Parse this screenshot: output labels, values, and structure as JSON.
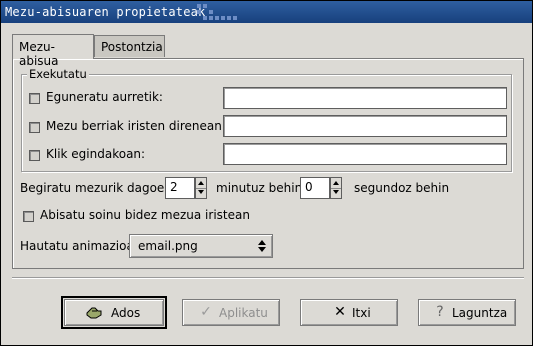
{
  "window": {
    "title": "Mezu-abisuaren propietateak"
  },
  "tabs": [
    {
      "label": "Mezu-abisua",
      "active": true
    },
    {
      "label": "Postontzia",
      "active": false
    }
  ],
  "exekutatu": {
    "group_label": "Exekutatu",
    "rows": [
      {
        "label": "Eguneratu aurretik:",
        "checked": false,
        "value": ""
      },
      {
        "label": "Mezu berriak iristen direnean:",
        "checked": false,
        "value": ""
      },
      {
        "label": "Klik egindakoan:",
        "checked": false,
        "value": ""
      }
    ]
  },
  "interval": {
    "prefix": "Begiratu mezurik dagoen",
    "minutes_value": "2",
    "minutes_label": "minutuz behin",
    "seconds_value": "0",
    "seconds_label": "segundoz behin"
  },
  "sound": {
    "label": "Abisatu soinu bidez mezua iristean",
    "checked": false
  },
  "animation": {
    "label": "Hautatu animazioa",
    "selected": "email.png"
  },
  "buttons": {
    "ok": "Ados",
    "apply": "Aplikatu",
    "close": "Itxi",
    "help": "Laguntza"
  },
  "colors": {
    "titlebar": "#17407d",
    "background": "#dcdad5"
  }
}
